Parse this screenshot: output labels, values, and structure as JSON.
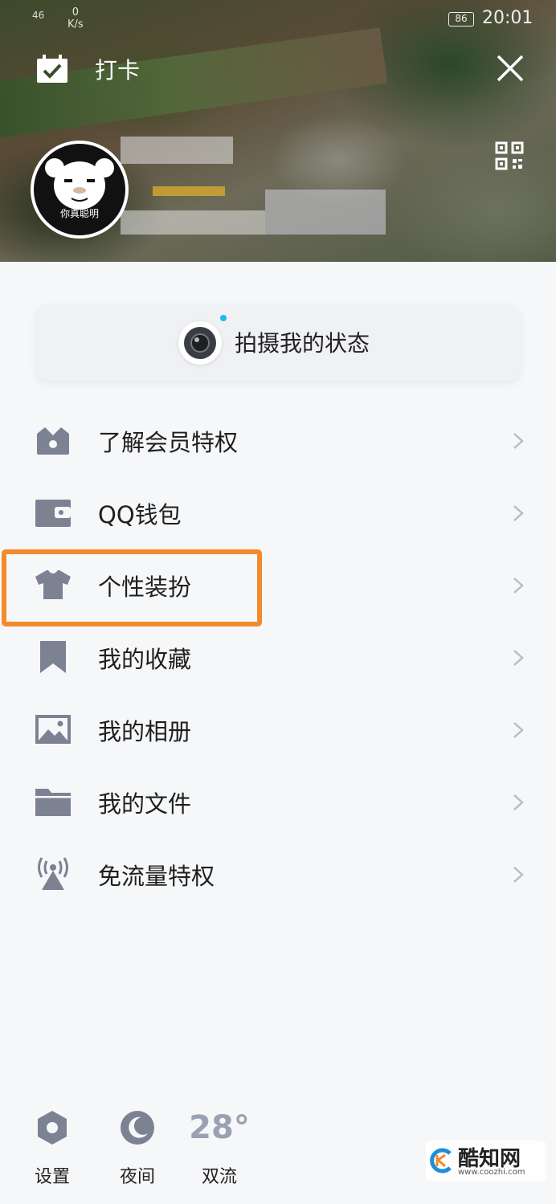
{
  "status_bar": {
    "signal": "46",
    "net_speed": "0",
    "net_unit": "K/s",
    "battery": "86",
    "time": "20:01"
  },
  "header": {
    "checkin_label": "打卡",
    "avatar_caption": "你真聪明"
  },
  "status_capture": {
    "label": "拍摄我的状态"
  },
  "menu": {
    "items": [
      {
        "label": "了解会员特权",
        "icon": "crown-icon"
      },
      {
        "label": "QQ钱包",
        "icon": "wallet-icon"
      },
      {
        "label": "个性装扮",
        "icon": "tshirt-icon"
      },
      {
        "label": "我的收藏",
        "icon": "bookmark-icon"
      },
      {
        "label": "我的相册",
        "icon": "photo-icon"
      },
      {
        "label": "我的文件",
        "icon": "folder-icon"
      },
      {
        "label": "免流量特权",
        "icon": "signal-tower-icon"
      }
    ]
  },
  "bottom": {
    "settings_label": "设置",
    "night_label": "夜间",
    "temperature": "28°",
    "city": "双流"
  },
  "watermark": {
    "name": "酷知网",
    "url": "www.coozhi.com"
  },
  "colors": {
    "icon_gray": "#7d8293",
    "highlight": "#f28a2e",
    "notification_dot": "#1fb6f5"
  }
}
